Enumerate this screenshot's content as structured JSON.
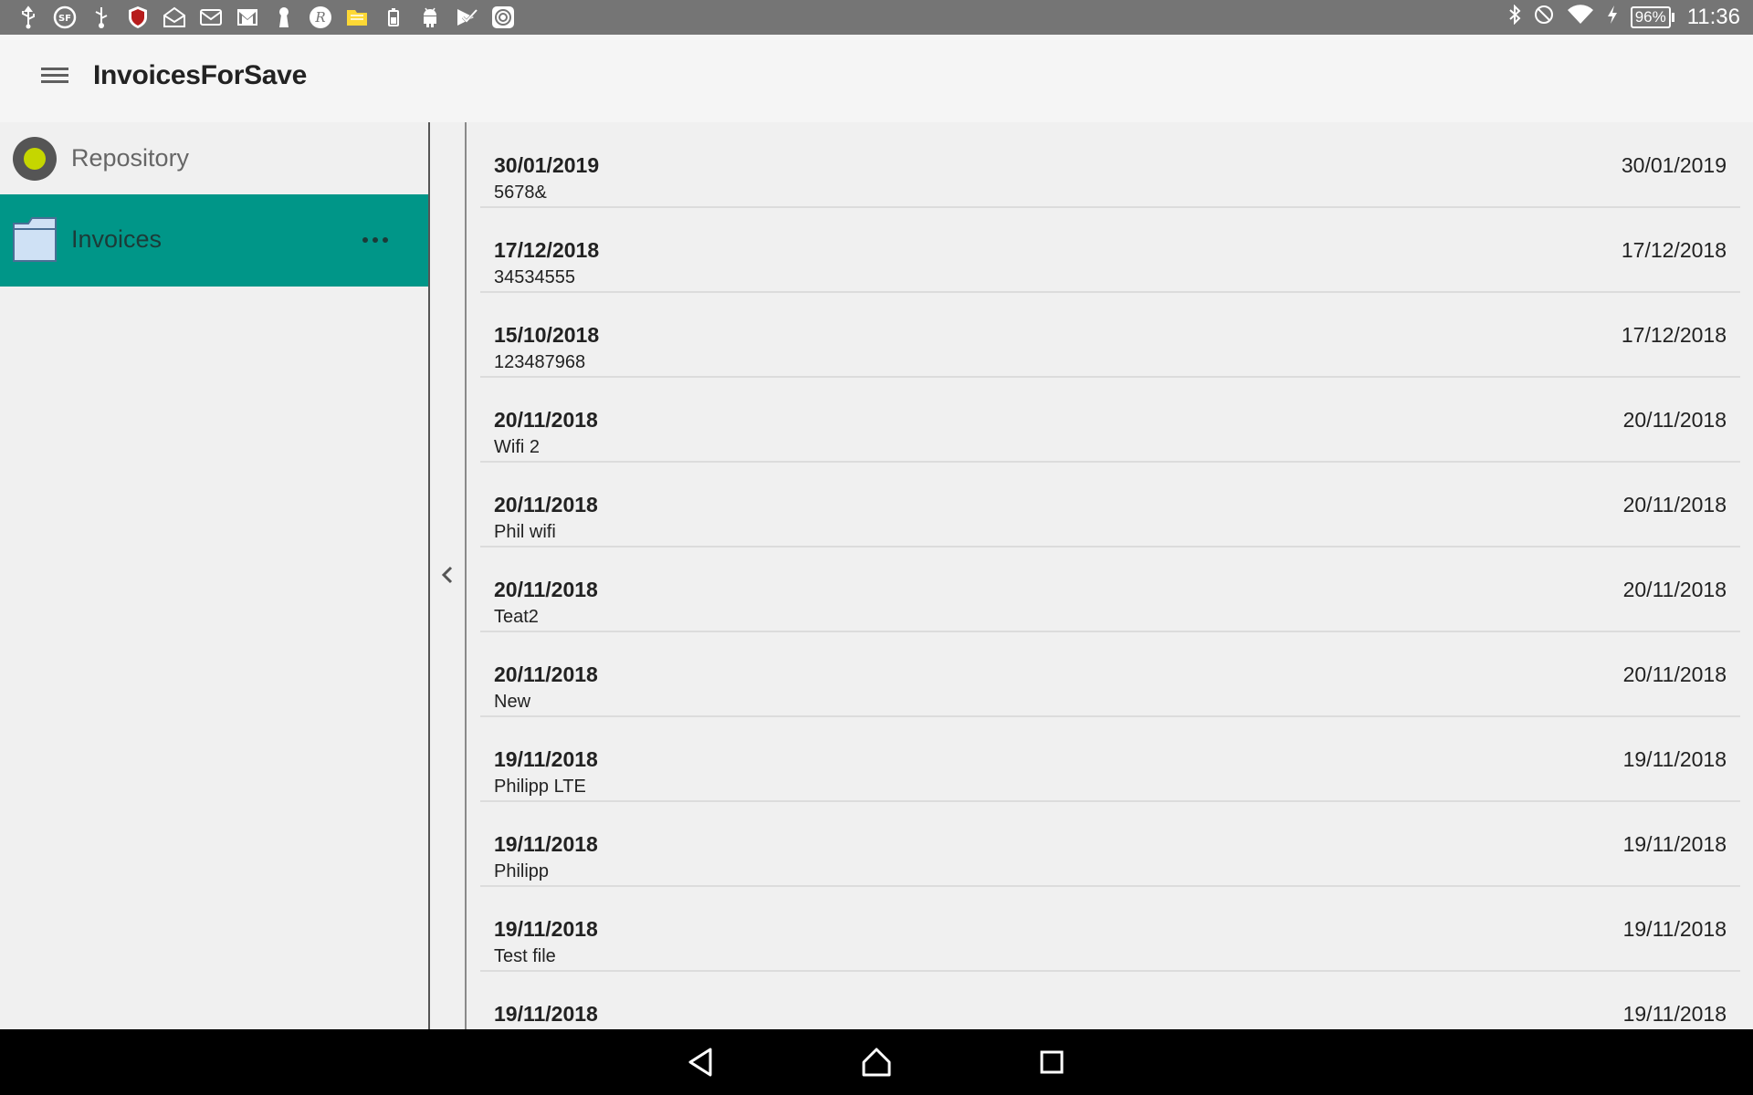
{
  "status_bar": {
    "notification_icons": [
      "usb-icon",
      "sf-icon",
      "usb-debug-icon",
      "mcafee-icon",
      "mail-open-icon",
      "mail-icon",
      "gmail-icon",
      "keyhole-icon",
      "r-icon",
      "folder-icon",
      "battery-saver-icon",
      "android-icon",
      "play-check-icon",
      "target-icon"
    ],
    "battery_percent": "96%",
    "time": "11:36"
  },
  "appbar": {
    "title": "InvoicesForSave"
  },
  "sidebar": {
    "repository_label": "Repository",
    "folder_label": "Invoices",
    "accent_color": "#009688"
  },
  "invoices": [
    {
      "title": "30/01/2019",
      "subtitle": "5678&",
      "date": "30/01/2019"
    },
    {
      "title": "17/12/2018",
      "subtitle": "34534555",
      "date": "17/12/2018"
    },
    {
      "title": "15/10/2018",
      "subtitle": "123487968",
      "date": "17/12/2018"
    },
    {
      "title": "20/11/2018",
      "subtitle": "Wifi 2",
      "date": "20/11/2018"
    },
    {
      "title": "20/11/2018",
      "subtitle": "Phil wifi",
      "date": "20/11/2018"
    },
    {
      "title": "20/11/2018",
      "subtitle": "Teat2",
      "date": "20/11/2018"
    },
    {
      "title": "20/11/2018",
      "subtitle": "New",
      "date": "20/11/2018"
    },
    {
      "title": "19/11/2018",
      "subtitle": "Philipp LTE",
      "date": "19/11/2018"
    },
    {
      "title": "19/11/2018",
      "subtitle": "Philipp",
      "date": "19/11/2018"
    },
    {
      "title": "19/11/2018",
      "subtitle": "Test file",
      "date": "19/11/2018"
    },
    {
      "title": "19/11/2018",
      "subtitle": "",
      "date": "19/11/2018"
    }
  ]
}
